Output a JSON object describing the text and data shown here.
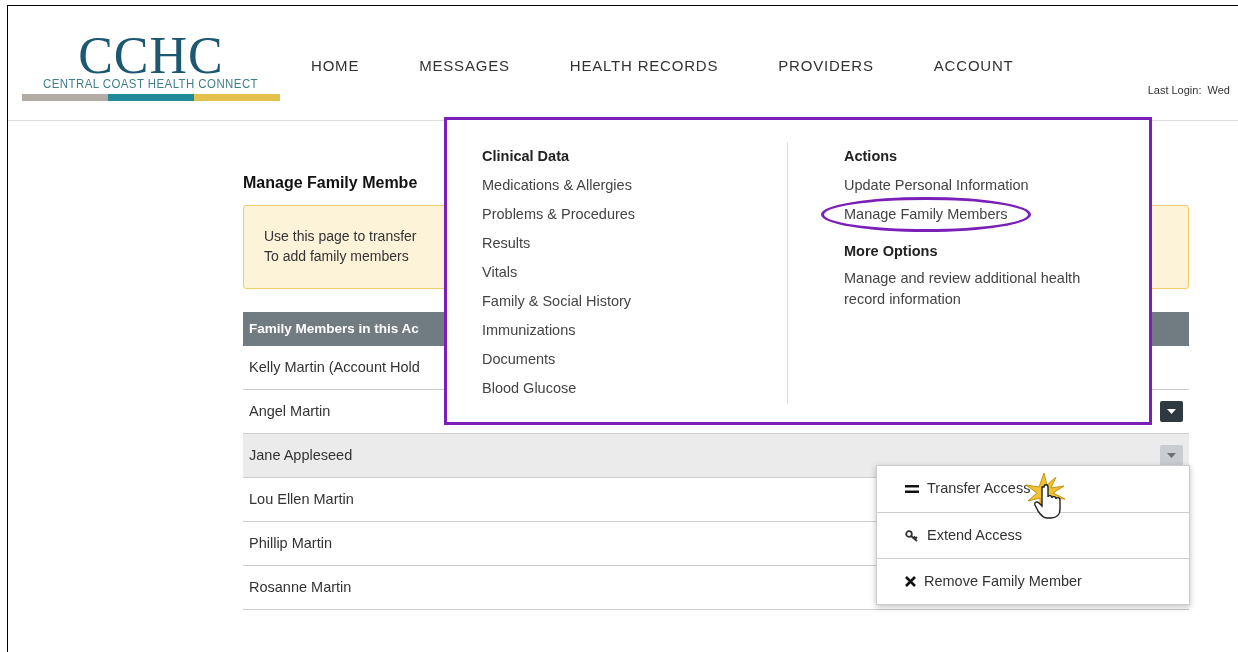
{
  "logo": {
    "mark": "CCHC",
    "tagline": "CENTRAL COAST HEALTH CONNECT"
  },
  "nav": [
    {
      "label": "HOME"
    },
    {
      "label": "MESSAGES"
    },
    {
      "label": "HEALTH RECORDS"
    },
    {
      "label": "PROVIDERS"
    },
    {
      "label": "ACCOUNT"
    }
  ],
  "last_login": "Last Login:  Wed",
  "page": {
    "title": "Manage Family Membe",
    "notice": [
      "Use this page to transfer",
      "To add family members"
    ],
    "table": {
      "header": "Family Members in this Ac",
      "rows": [
        {
          "name": "Kelly Martin (Account Hold",
          "selected": false
        },
        {
          "name": "Angel Martin",
          "selected": false,
          "toggle": {
            "open": false
          }
        },
        {
          "name": "Jane Appleseed",
          "selected": true,
          "toggle": {
            "open": true
          }
        },
        {
          "name": "Lou Ellen Martin",
          "selected": false
        },
        {
          "name": "Phillip Martin",
          "selected": false
        },
        {
          "name": "Rosanne Martin",
          "selected": false
        }
      ]
    }
  },
  "mega_menu": {
    "columns": [
      {
        "sections": [
          {
            "heading": "Clinical Data",
            "items": [
              {
                "label": "Medications & Allergies",
                "circled": false
              },
              {
                "label": "Problems & Procedures",
                "circled": false
              },
              {
                "label": "Results",
                "circled": false
              },
              {
                "label": "Vitals",
                "circled": false
              },
              {
                "label": "Family & Social History",
                "circled": false
              },
              {
                "label": "Immunizations",
                "circled": false
              },
              {
                "label": "Documents",
                "circled": false
              },
              {
                "label": "Blood Glucose",
                "circled": false
              }
            ]
          }
        ]
      },
      {
        "sections": [
          {
            "heading": "Actions",
            "items": [
              {
                "label": "Update Personal Information",
                "circled": false
              },
              {
                "label": "Manage Family Members",
                "circled": true
              }
            ]
          },
          {
            "heading": "More Options",
            "description": "Manage and review additional health record information"
          }
        ]
      }
    ]
  },
  "row_menu": [
    {
      "kind": "transfer",
      "label": "Transfer Access"
    },
    {
      "kind": "extend",
      "label": "Extend Access"
    },
    {
      "kind": "remove",
      "label": "Remove Family Member"
    }
  ]
}
